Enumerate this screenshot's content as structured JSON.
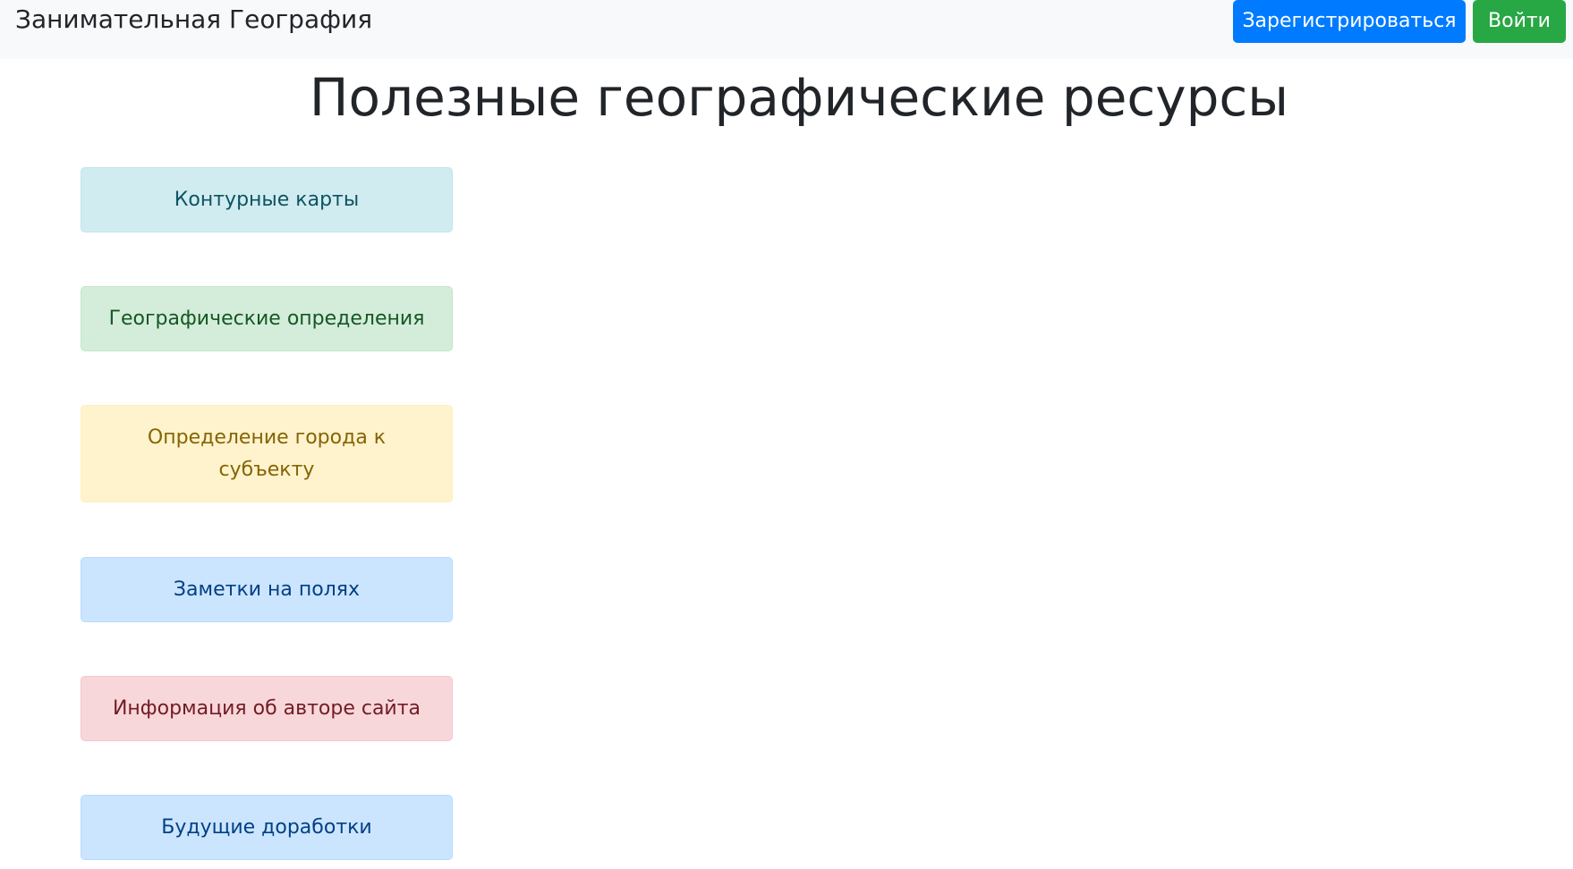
{
  "navbar": {
    "brand": "Занимательная География",
    "register_label": "Зарегистрироваться",
    "login_label": "Войти"
  },
  "page": {
    "title": "Полезные географические ресурсы"
  },
  "resources": [
    {
      "label": "Контурные карты",
      "style": "info"
    },
    {
      "label": "Географические определения",
      "style": "success"
    },
    {
      "label": "Определение города к субъекту",
      "style": "warning"
    },
    {
      "label": "Заметки на полях",
      "style": "primary"
    },
    {
      "label": "Информация об авторе сайта",
      "style": "danger"
    },
    {
      "label": "Будущие доработки",
      "style": "primary"
    }
  ],
  "colors": {
    "register_button": "#007bff",
    "login_button": "#28a745",
    "navbar_background": "#f8f9fa"
  }
}
